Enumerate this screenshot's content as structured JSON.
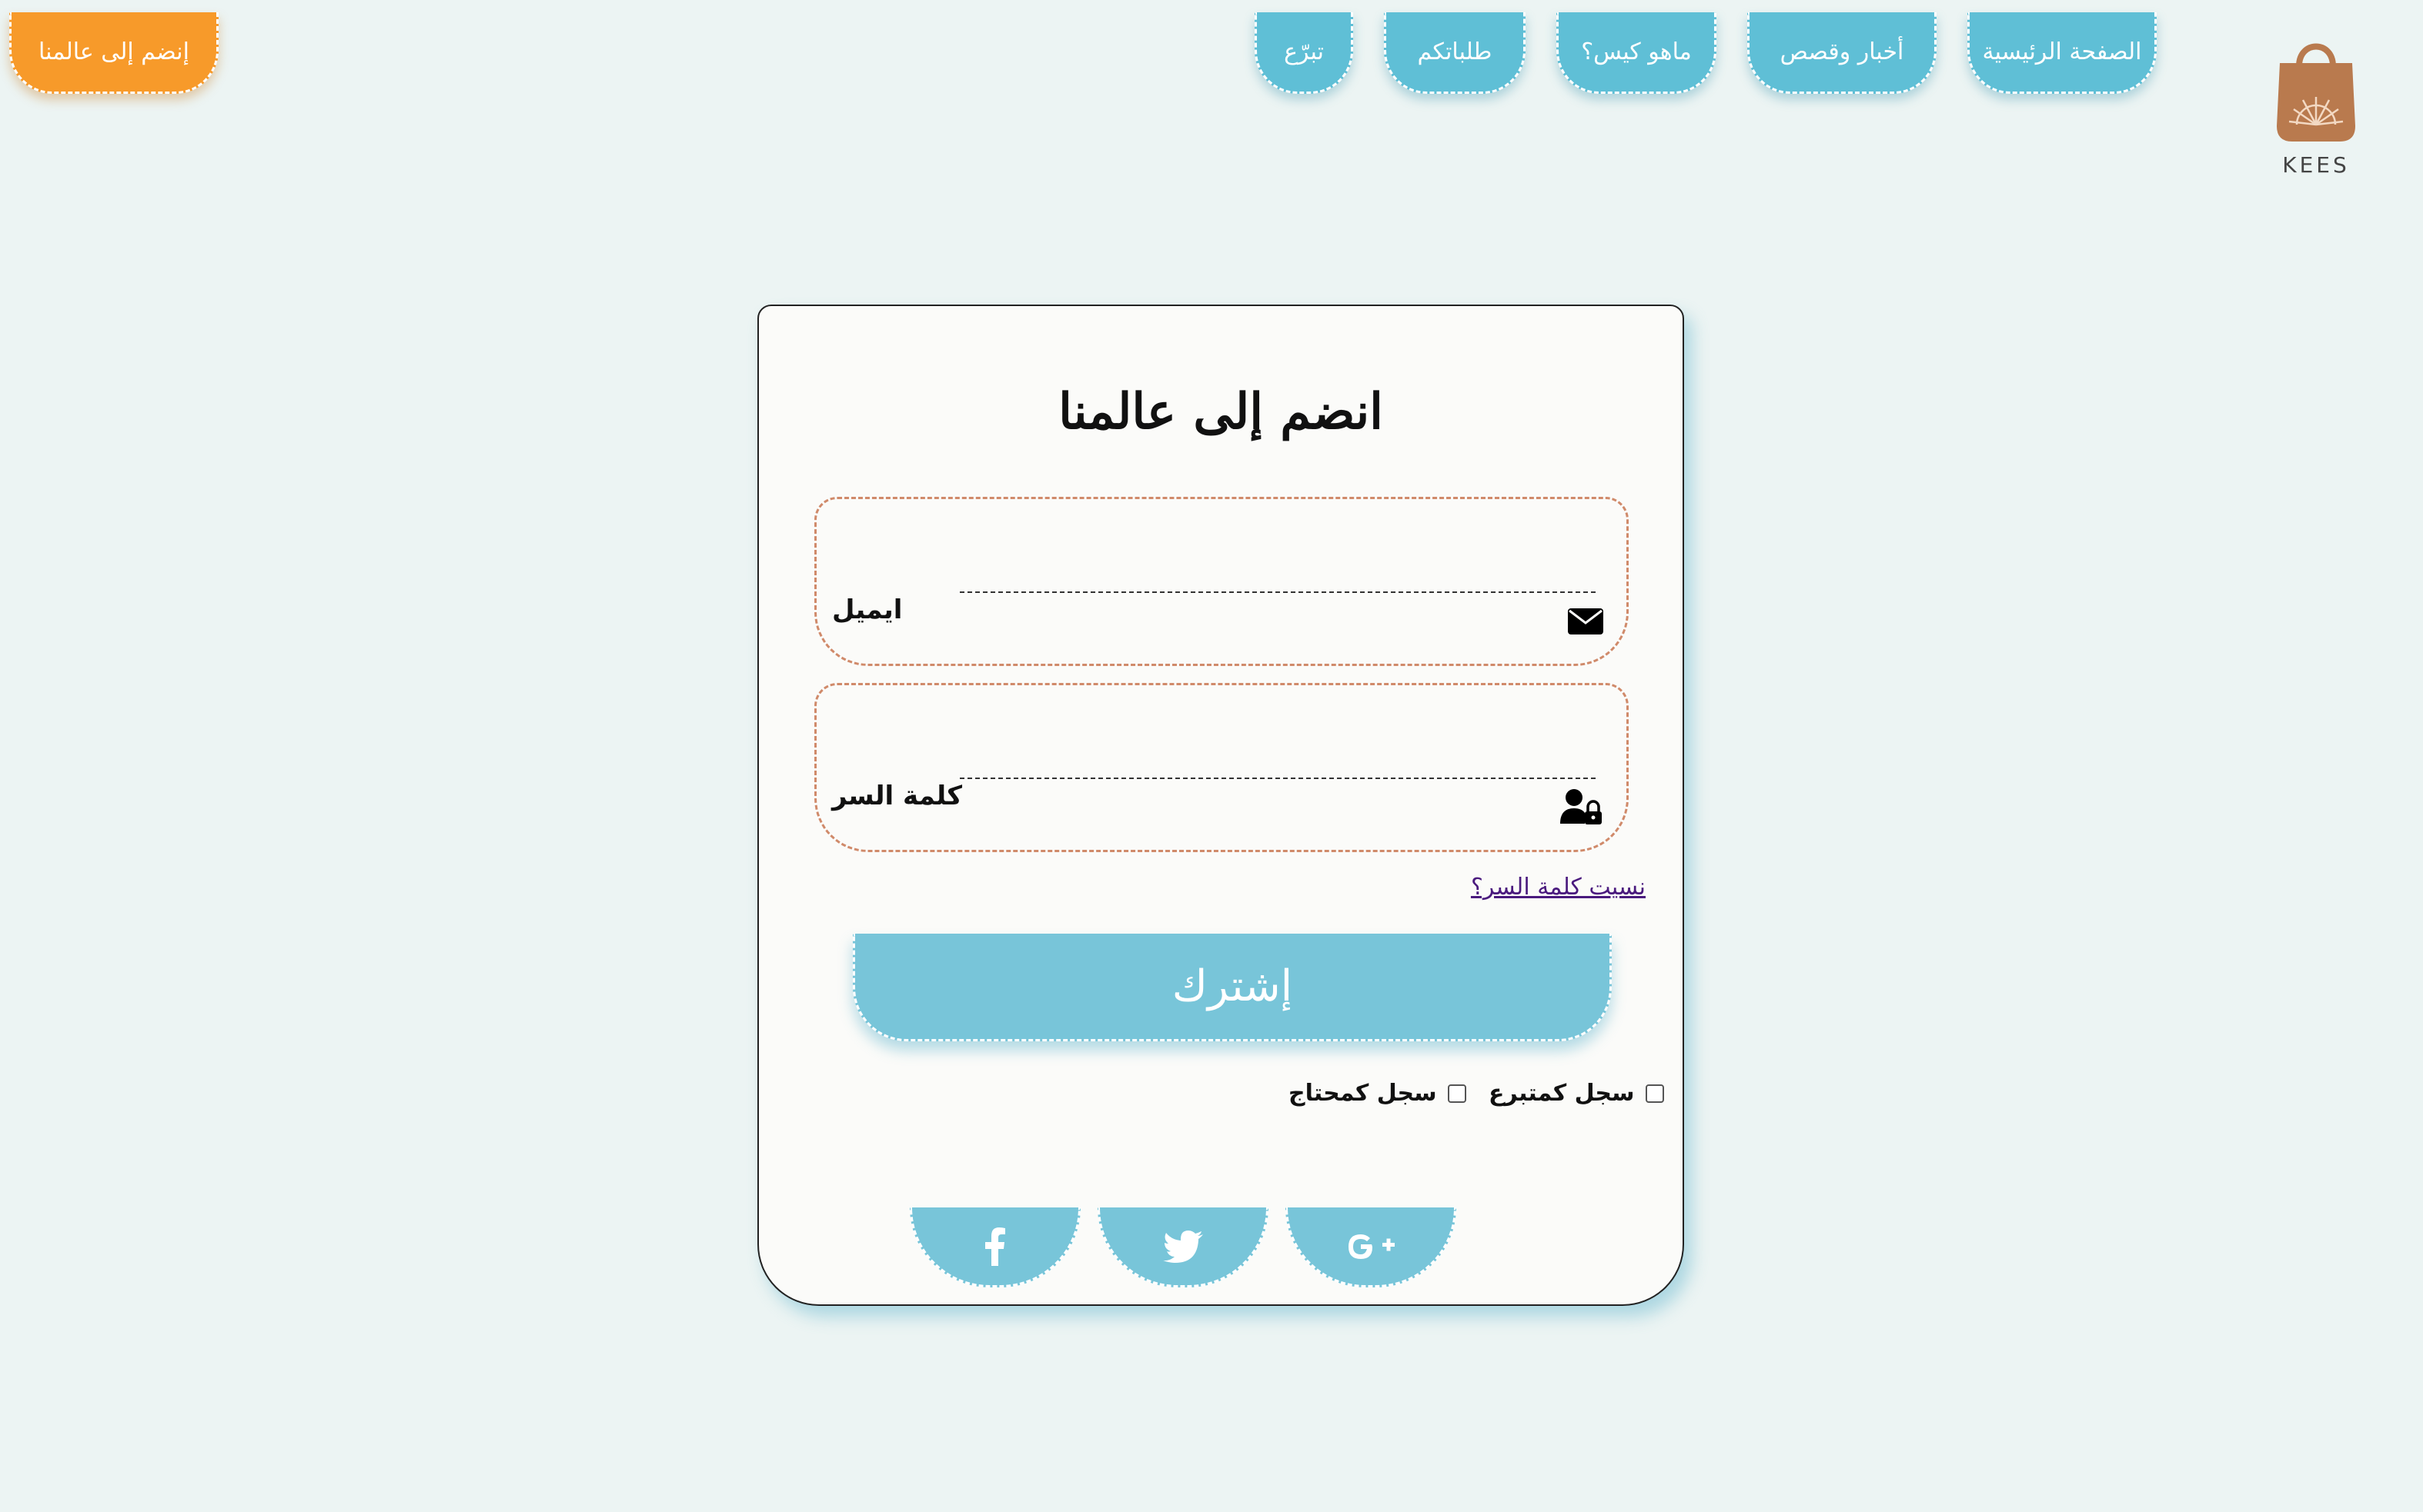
{
  "brand": {
    "name": "KEES",
    "bag_color": "#b97a4e"
  },
  "nav": {
    "items": [
      {
        "label": "الصفحة الرئيسية"
      },
      {
        "label": "أخبار وقصص"
      },
      {
        "label": "ماهو كيس؟"
      },
      {
        "label": "طلباتكم"
      },
      {
        "label": "تبرّع"
      }
    ],
    "join_label": "إنضم إلى عالمنا"
  },
  "form": {
    "title": "انضم إلى عالمنا",
    "email": {
      "label": "ايميل",
      "value": "",
      "icon": "envelope-icon"
    },
    "password": {
      "label": "كلمة السر",
      "value": "",
      "icon": "user-lock-icon"
    },
    "forgot_label": "نسيت كلمة السر؟",
    "submit_label": "إشترك",
    "checkboxes": [
      {
        "label": "سجل كمتبرع",
        "checked": false
      },
      {
        "label": "سجل كمحتاج",
        "checked": false
      }
    ],
    "social": [
      {
        "icon": "facebook-icon"
      },
      {
        "icon": "twitter-icon"
      },
      {
        "icon": "google-plus-icon"
      }
    ]
  },
  "colors": {
    "accent": "#5fbfd6",
    "button": "#78c5d9",
    "join": "#f79a2a",
    "field_border": "#d08a6a",
    "background": "#ecf4f3"
  }
}
